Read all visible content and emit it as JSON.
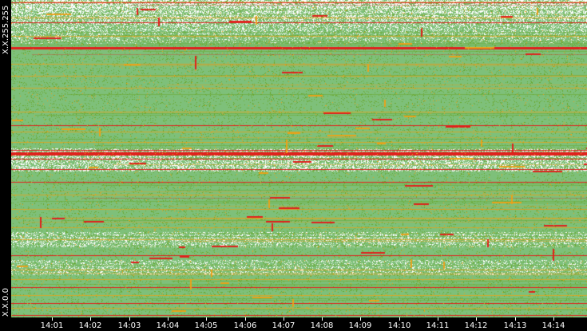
{
  "chart_data": {
    "type": "heatmap",
    "title": "",
    "xlabel": "",
    "ylabel": "",
    "y_tick_labels": {
      "top": "X.X.255.255",
      "bottom": "X.X.0.0"
    },
    "y_range": [
      "X.X.0.0",
      "X.X.255.255"
    ],
    "x_tick_labels": [
      "14:01",
      "14:02",
      "14:03",
      "14:04",
      "14:05",
      "14:06",
      "14:07",
      "14:08",
      "14:09",
      "14:10",
      "14:11",
      "14:12",
      "14:13",
      "14:14"
    ],
    "x_range": [
      "14:00:45",
      "14:15:00"
    ],
    "colors": {
      "background": "#000000",
      "low": "#7ec07a",
      "mid": "#6aa82e",
      "high": "#e9a21a",
      "peak": "#e0201c",
      "sparse": "#ffffff"
    },
    "grid": false,
    "legend": "none"
  }
}
